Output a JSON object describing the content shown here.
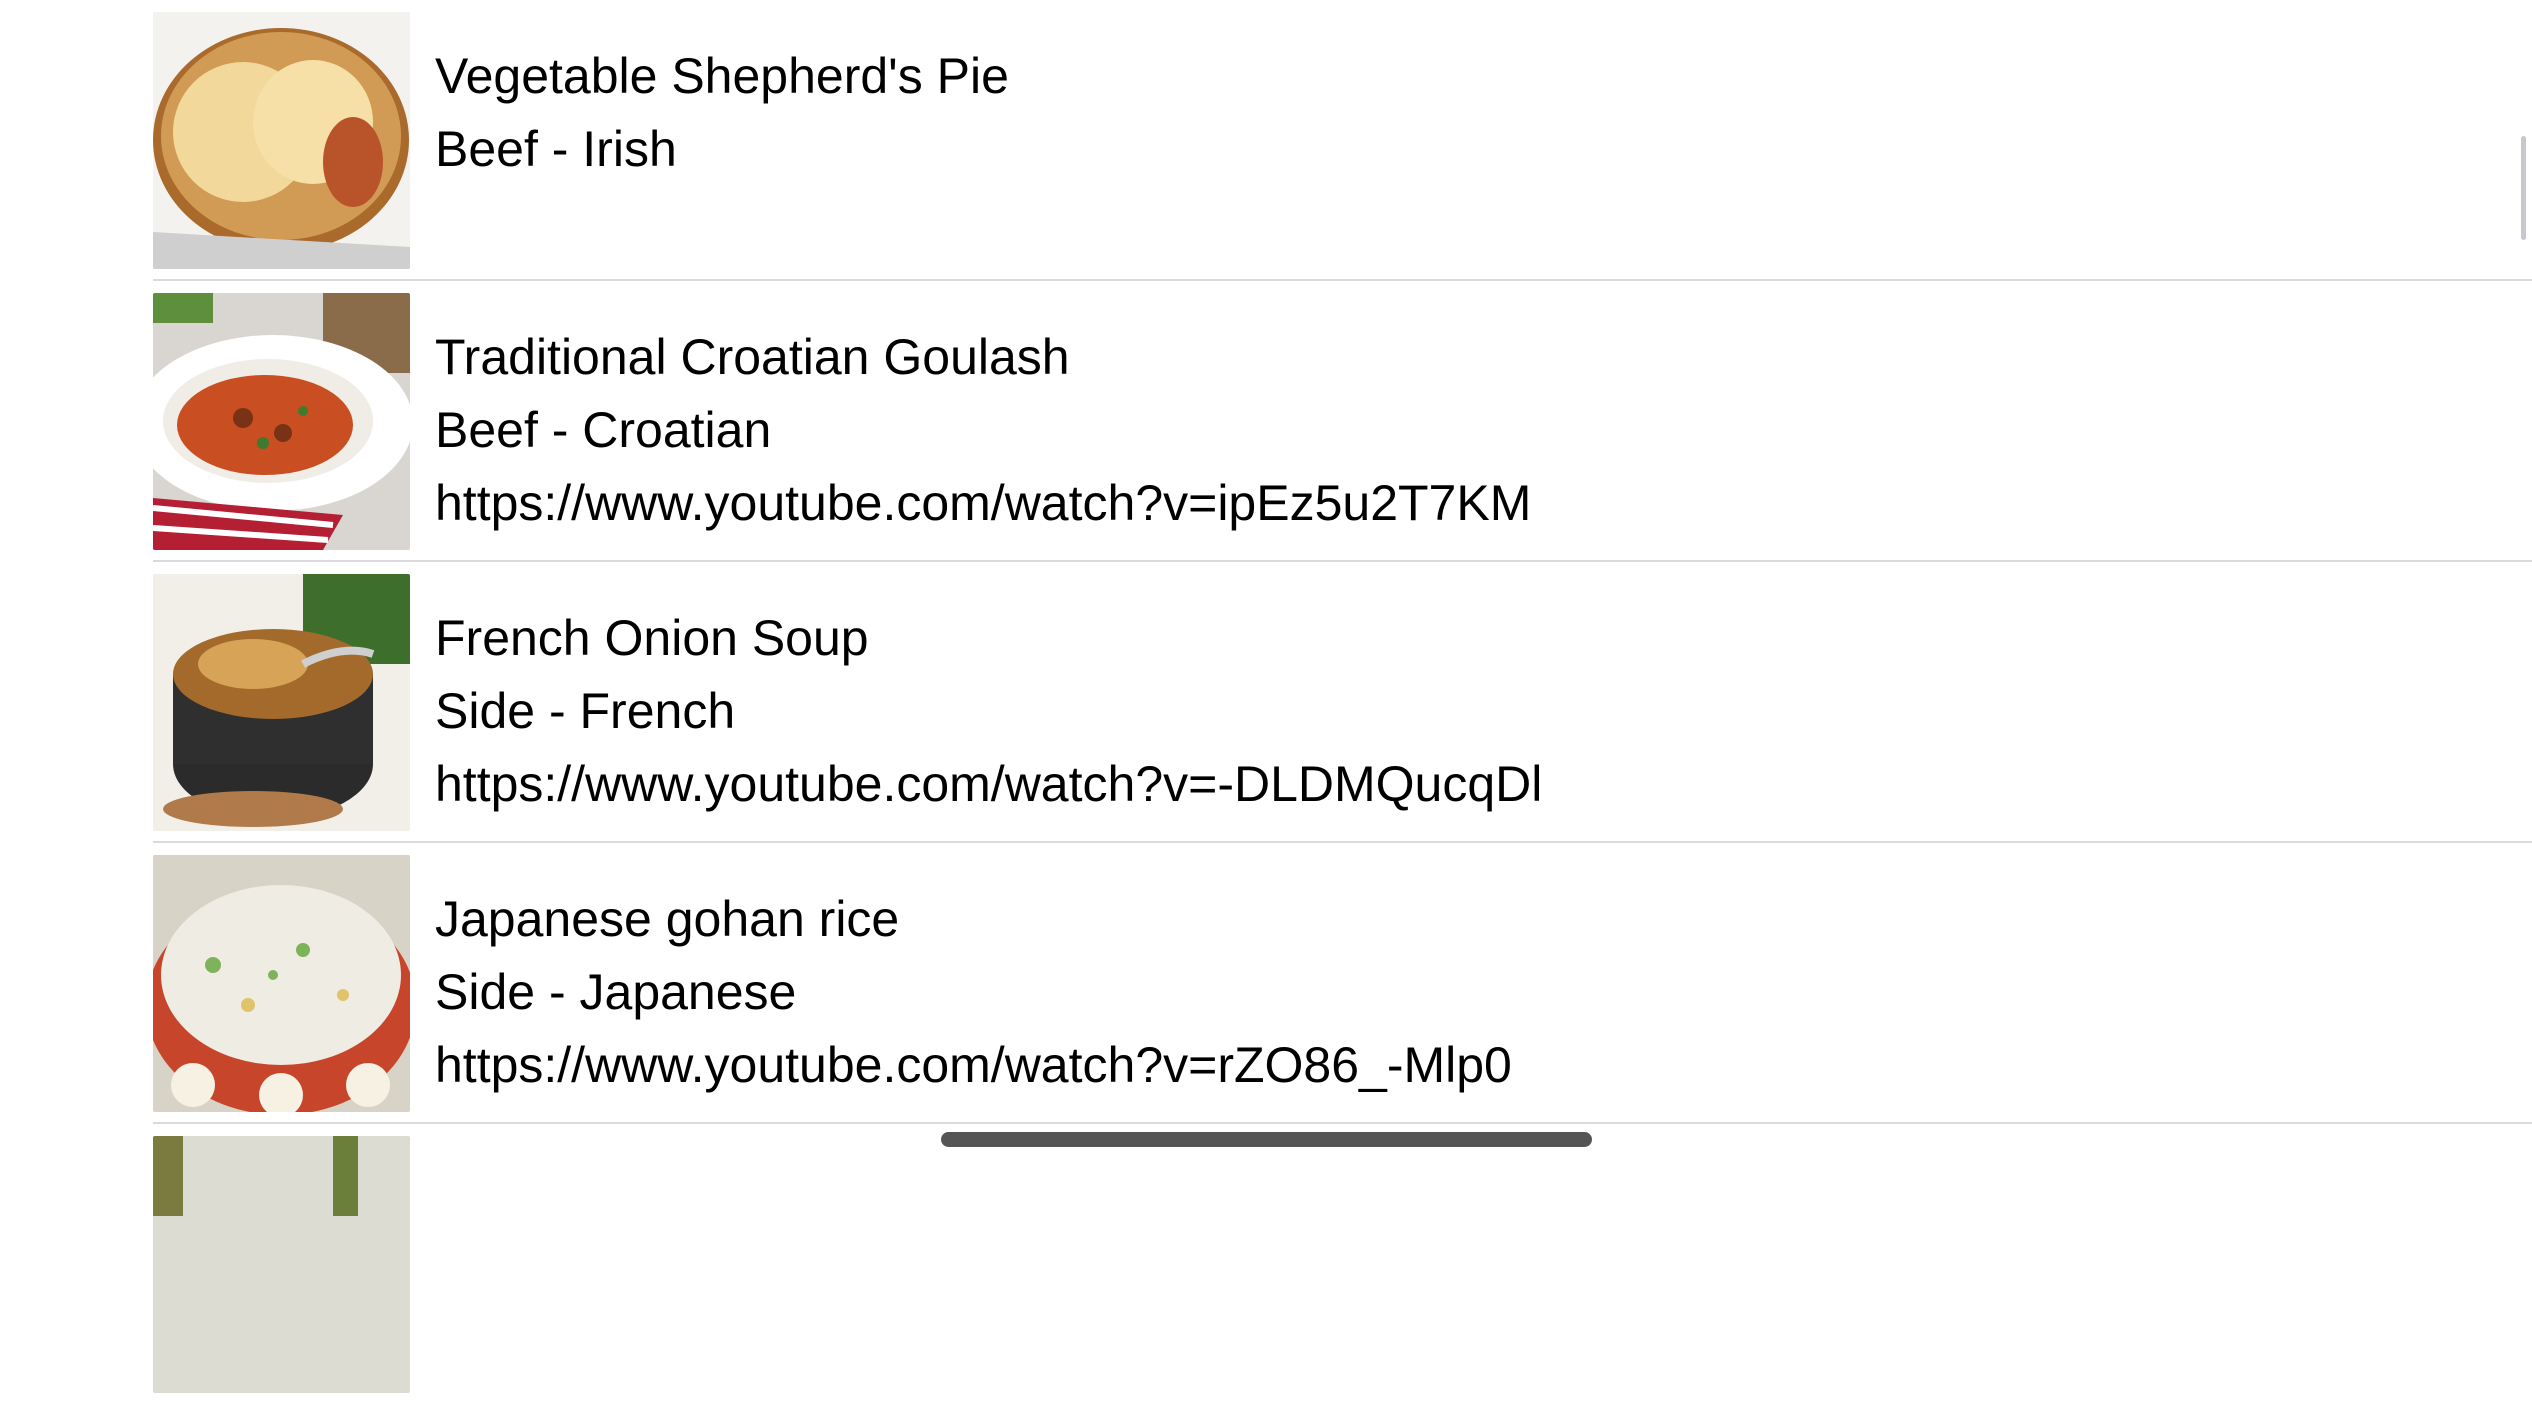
{
  "meals": [
    {
      "title": "Vegetable Shepherd's Pie",
      "category": "Beef - Irish",
      "youtube": "",
      "thumbnail": "shepherds-pie"
    },
    {
      "title": "Traditional Croatian Goulash",
      "category": "Beef - Croatian",
      "youtube": "https://www.youtube.com/watch?v=ipEz5u2T7KM",
      "thumbnail": "goulash"
    },
    {
      "title": "French Onion Soup",
      "category": "Side - French",
      "youtube": "https://www.youtube.com/watch?v=-DLDMQucqDl",
      "thumbnail": "onion-soup"
    },
    {
      "title": "Japanese gohan rice",
      "category": "Side - Japanese",
      "youtube": "https://www.youtube.com/watch?v=rZO86_-Mlp0",
      "thumbnail": "gohan-rice"
    },
    {
      "title": "",
      "category": "",
      "youtube": "",
      "thumbnail": "partial"
    }
  ]
}
